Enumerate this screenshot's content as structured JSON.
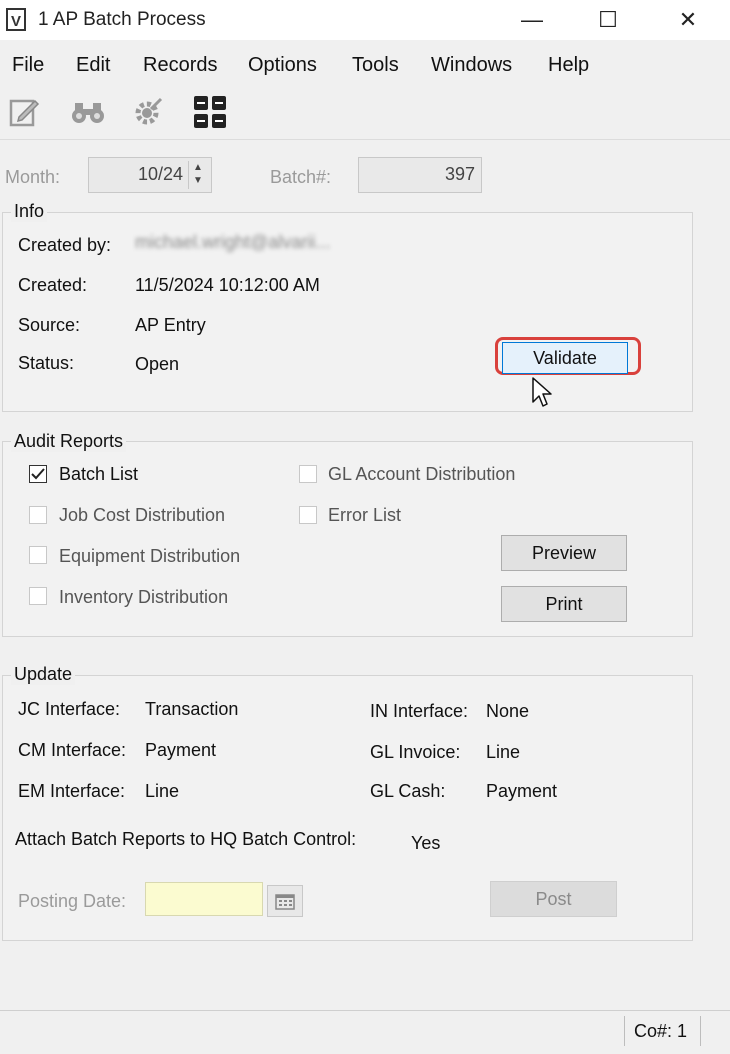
{
  "window": {
    "title": "1 AP Batch Process",
    "minimize_glyph": "—",
    "maximize_glyph": "☐",
    "close_glyph": "✕"
  },
  "menu": [
    "File",
    "Edit",
    "Records",
    "Options",
    "Tools",
    "Windows",
    "Help"
  ],
  "toolbar": {
    "icons": [
      "edit-icon",
      "binoculars-icon",
      "gear-icon",
      "grid-icon"
    ]
  },
  "header": {
    "month_label": "Month:",
    "month_value": "10/24",
    "batch_label": "Batch#:",
    "batch_value": "397"
  },
  "info": {
    "title": "Info",
    "created_by_label": "Created by:",
    "created_by_value": "michael.wright@alvarii...",
    "created_label": "Created:",
    "created_value": "11/5/2024 10:12:00 AM",
    "source_label": "Source:",
    "source_value": "AP Entry",
    "status_label": "Status:",
    "status_value": "Open",
    "validate_button": "Validate",
    "highlight_color": "#d9413c"
  },
  "audit": {
    "title": "Audit Reports",
    "batch_list": "Batch List",
    "job_cost": "Job Cost Distribution",
    "equipment": "Equipment Distribution",
    "inventory": "Inventory Distribution",
    "gl_account": "GL Account Distribution",
    "error_list": "Error List",
    "preview_button": "Preview",
    "print_button": "Print",
    "batch_list_checked": true
  },
  "update": {
    "title": "Update",
    "jc_label": "JC Interface:",
    "jc_value": "Transaction",
    "cm_label": "CM Interface:",
    "cm_value": "Payment",
    "em_label": "EM Interface:",
    "em_value": "Line",
    "in_label": "IN Interface:",
    "in_value": "None",
    "gl_invoice_label": "GL Invoice:",
    "gl_invoice_value": "Line",
    "gl_cash_label": "GL Cash:",
    "gl_cash_value": "Payment",
    "attach_label": "Attach Batch Reports to HQ Batch Control:",
    "attach_value": "Yes",
    "posting_date_label": "Posting Date:",
    "posting_date_value": "",
    "post_button": "Post"
  },
  "statusbar": {
    "company": "Co#: 1"
  }
}
